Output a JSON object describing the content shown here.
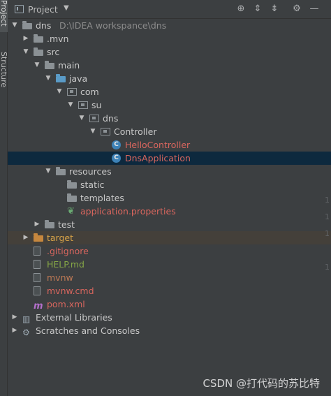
{
  "side_tabs": [
    "Project",
    "Structure"
  ],
  "toolbar": {
    "title": "Project",
    "dropdown_glyph": "▼",
    "icons": [
      {
        "name": "locate-icon",
        "glyph": "⊕"
      },
      {
        "name": "expand-all-icon",
        "glyph": "⇕"
      },
      {
        "name": "collapse-all-icon",
        "glyph": "⇟"
      },
      {
        "name": "gear-icon",
        "glyph": "⚙"
      },
      {
        "name": "hide-icon",
        "glyph": "—"
      }
    ]
  },
  "tree": [
    {
      "label": "dns",
      "hint": "D:\\IDEA workspance\\dns",
      "arrow": "▼",
      "icon": "folder-g",
      "color": "c-def"
    },
    {
      "label": ".mvn",
      "arrow": "▶",
      "icon": "folder-g",
      "color": "c-def"
    },
    {
      "label": "src",
      "arrow": "▼",
      "icon": "folder-g",
      "color": "c-def"
    },
    {
      "label": "main",
      "arrow": "▼",
      "icon": "folder-g",
      "color": "c-def"
    },
    {
      "label": "java",
      "arrow": "▼",
      "icon": "folder-b",
      "color": "c-def"
    },
    {
      "label": "com",
      "arrow": "▼",
      "icon": "pkg",
      "color": "c-def"
    },
    {
      "label": "su",
      "arrow": "▼",
      "icon": "pkg",
      "color": "c-def"
    },
    {
      "label": "dns",
      "arrow": "▼",
      "icon": "pkg",
      "color": "c-def"
    },
    {
      "label": "Controller",
      "arrow": "▼",
      "icon": "pkg",
      "color": "c-def"
    },
    {
      "label": "HelloController",
      "arrow": "",
      "icon": "cls-c",
      "color": "c-red"
    },
    {
      "label": "DnsApplication",
      "arrow": "",
      "icon": "cls-c",
      "color": "c-red",
      "selected": true
    },
    {
      "label": "resources",
      "arrow": "▼",
      "icon": "folder-g",
      "color": "c-def"
    },
    {
      "label": "static",
      "arrow": "",
      "icon": "folder-g",
      "color": "c-def"
    },
    {
      "label": "templates",
      "arrow": "",
      "icon": "folder-g",
      "color": "c-def"
    },
    {
      "label": "application.properties",
      "arrow": "",
      "icon": "leaf",
      "color": "c-red"
    },
    {
      "label": "test",
      "arrow": "▶",
      "icon": "folder-g",
      "color": "c-def"
    },
    {
      "label": "target",
      "arrow": "▶",
      "icon": "folder-o",
      "color": "c-orange",
      "excluded": true
    },
    {
      "label": ".gitignore",
      "arrow": "",
      "icon": "file-ic",
      "color": "c-red"
    },
    {
      "label": "HELP.md",
      "arrow": "",
      "icon": "file-ic",
      "color": "c-green"
    },
    {
      "label": "mvnw",
      "arrow": "",
      "icon": "file-ic",
      "color": "c-brown"
    },
    {
      "label": "mvnw.cmd",
      "arrow": "",
      "icon": "file-ic",
      "color": "c-red"
    },
    {
      "label": "pom.xml",
      "arrow": "",
      "icon": "mvn-ic",
      "color": "c-red"
    },
    {
      "label": "External Libraries",
      "arrow": "▶",
      "icon": "lib-ic",
      "color": "c-def"
    },
    {
      "label": "Scratches and Consoles",
      "arrow": "▶",
      "icon": "lib-ic",
      "color": "c-def"
    }
  ],
  "gutter_numbers": [
    "1",
    "1",
    "1",
    "1"
  ],
  "watermark": "CSDN @打代码的苏比特"
}
